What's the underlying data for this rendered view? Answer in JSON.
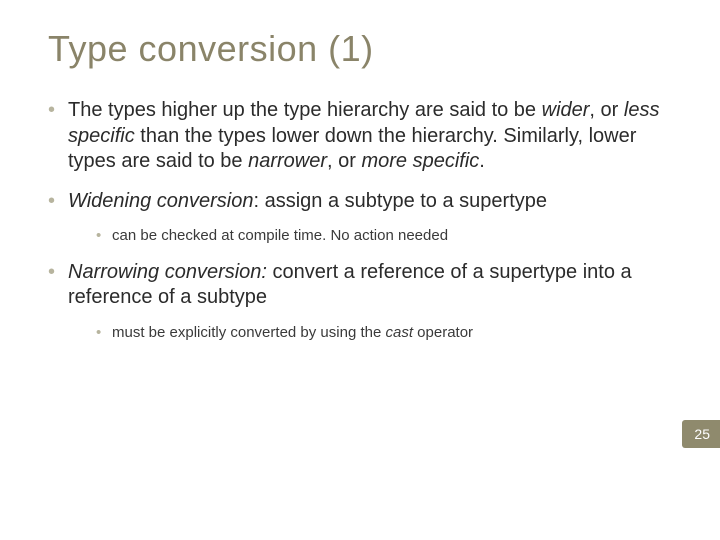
{
  "title": "Type conversion (1)",
  "bullets": {
    "b1": {
      "t1": "The types higher up the type hierarchy are said to be ",
      "e1": "wider",
      "t2": ", or ",
      "e2": "less specific",
      "t3": " than the types lower down the hierarchy. Similarly, lower types are said to be ",
      "e3": "narrower",
      "t4": ", or ",
      "e4": "more specific",
      "t5": "."
    },
    "b2": {
      "e1": "Widening conversion",
      "t1": ": assign a subtype to a supertype",
      "sub1": "can be checked at compile time. No action needed"
    },
    "b3": {
      "e1": "Narrowing conversion:",
      "t1": " convert a reference of a supertype into a reference of a subtype",
      "sub1_a": "must be explicitly converted by using the ",
      "sub1_e": "cast",
      "sub1_b": " operator"
    }
  },
  "page_number": "25"
}
